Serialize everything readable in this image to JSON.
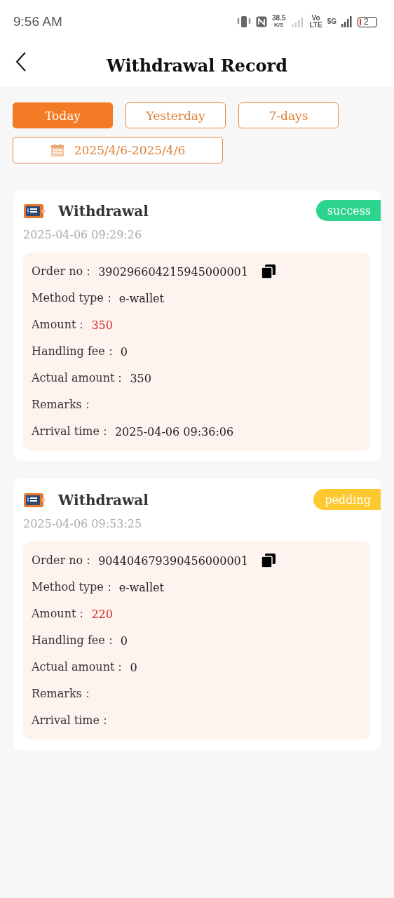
{
  "status_bar": {
    "time": "9:56 AM",
    "speed": "38.5",
    "speed_unit": "K/S",
    "volte_top": "Vo",
    "volte_bottom": "LTE",
    "network": "5G",
    "battery": "2"
  },
  "header": {
    "title": "Withdrawal Record"
  },
  "filters": [
    {
      "label": "Today",
      "selected": true
    },
    {
      "label": "Yesterday",
      "selected": false
    },
    {
      "label": "7-days",
      "selected": false
    }
  ],
  "date_range": "2025/4/6-2025/4/6",
  "records": [
    {
      "title": "Withdrawal",
      "status": "success",
      "color": "#2dd48e",
      "time": "2025-04-06 09:29:26",
      "fields": [
        {
          "kind": "order",
          "label": "Order no：",
          "value": "390296604215945000001"
        },
        {
          "kind": "plain",
          "label": "Method type：",
          "value": "e-wallet"
        },
        {
          "kind": "amount",
          "label": "Amount：",
          "value": "350"
        },
        {
          "kind": "plain",
          "label": "Handling fee：",
          "value": "0"
        },
        {
          "kind": "plain",
          "label": "Actual amount：",
          "value": "350"
        },
        {
          "kind": "plain",
          "label": "Remarks："
        },
        {
          "kind": "plain",
          "label": "Arrival time：",
          "value": "2025-04-06 09:36:06"
        }
      ]
    },
    {
      "title": "Withdrawal",
      "status": "pedding",
      "color": "#fdc92e",
      "time": "2025-04-06 09:53:25",
      "fields": [
        {
          "kind": "order",
          "label": "Order no：",
          "value": "904404679390456000001"
        },
        {
          "kind": "plain",
          "label": "Method type：",
          "value": "e-wallet"
        },
        {
          "kind": "amount",
          "label": "Amount：",
          "value": "220"
        },
        {
          "kind": "plain",
          "label": "Handling fee：",
          "value": "0"
        },
        {
          "kind": "plain",
          "label": "Actual amount：",
          "value": "0"
        },
        {
          "kind": "plain",
          "label": "Remarks："
        },
        {
          "kind": "plain",
          "label": "Arrival time："
        }
      ]
    }
  ]
}
